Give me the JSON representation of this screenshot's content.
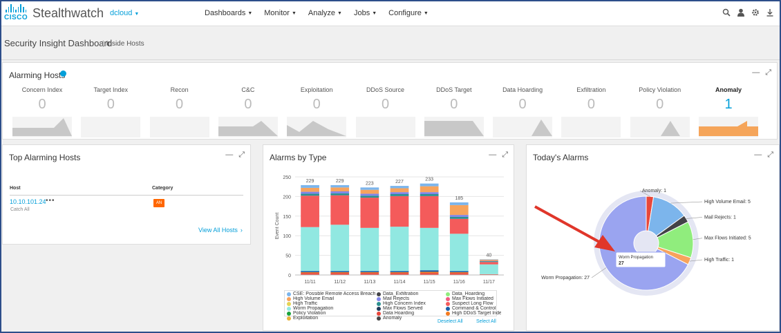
{
  "app": {
    "logo_text": "CISCO",
    "title": "Stealthwatch",
    "tenant": "dcloud"
  },
  "nav": [
    {
      "label": "Dashboards"
    },
    {
      "label": "Monitor"
    },
    {
      "label": "Analyze"
    },
    {
      "label": "Jobs"
    },
    {
      "label": "Configure"
    }
  ],
  "toolbar_icons": [
    "search-icon",
    "user-icon",
    "gear-icon",
    "download-icon"
  ],
  "page": {
    "title": "Security Insight Dashboard",
    "subtitle": "Inside Hosts"
  },
  "alarming_hosts": {
    "title": "Alarming Hosts",
    "tiles": [
      {
        "label": "Concern Index",
        "value": "0"
      },
      {
        "label": "Target Index",
        "value": "0"
      },
      {
        "label": "Recon",
        "value": "0"
      },
      {
        "label": "C&C",
        "value": "0"
      },
      {
        "label": "Exploitation",
        "value": "0"
      },
      {
        "label": "DDoS Source",
        "value": "0"
      },
      {
        "label": "DDoS Target",
        "value": "0"
      },
      {
        "label": "Data Hoarding",
        "value": "0"
      },
      {
        "label": "Exfiltration",
        "value": "0"
      },
      {
        "label": "Policy Violation",
        "value": "0"
      },
      {
        "label": "Anomaly",
        "value": "1"
      }
    ]
  },
  "top_alarming_hosts": {
    "title": "Top Alarming Hosts",
    "col_host": "Host",
    "col_category": "Category",
    "rows": [
      {
        "host": "10.10.101.24",
        "more": "•••",
        "sub": "Catch All",
        "category": "AN"
      }
    ],
    "view_all": "View All Hosts"
  },
  "alarms_by_type": {
    "title": "Alarms by Type",
    "deselect_all": "Deselect All",
    "select_all": "Select All",
    "legend": [
      {
        "label": "CSE: Possible Remote Access Breach",
        "color": "#7cb5ec"
      },
      {
        "label": "Data_Exfiltration",
        "color": "#434348"
      },
      {
        "label": "Data_Hoarding",
        "color": "#90ed7d"
      },
      {
        "label": "High Volume Email",
        "color": "#f7a35c"
      },
      {
        "label": "Mail Rejects",
        "color": "#8085e9"
      },
      {
        "label": "Max Flows Initiated",
        "color": "#f15c80"
      },
      {
        "label": "High Traffic",
        "color": "#e4d354"
      },
      {
        "label": "High Concern Index",
        "color": "#2b908f"
      },
      {
        "label": "Suspect Long Flow",
        "color": "#f45b5b"
      },
      {
        "label": "Worm Propagation",
        "color": "#91e8e1"
      },
      {
        "label": "Max Flows Served",
        "color": "#1f3a5a"
      },
      {
        "label": "Command & Control",
        "color": "#1a5fa8"
      },
      {
        "label": "Policy Violation",
        "color": "#1aa33a"
      },
      {
        "label": "Data Hoarding",
        "color": "#e8473b"
      },
      {
        "label": "High DDoS Target Index",
        "color": "#f47b20"
      },
      {
        "label": "Exploitation",
        "color": "#e8b339"
      },
      {
        "label": "Anomaly",
        "color": "#444444"
      }
    ]
  },
  "todays_alarms": {
    "title": "Today's Alarms",
    "tooltip_label": "Worm Propagation",
    "tooltip_value": "27"
  },
  "chart_data": [
    {
      "type": "bar",
      "title": "Alarms by Type",
      "xlabel": "",
      "ylabel": "Event Count",
      "ylim": [
        0,
        250
      ],
      "yticks": [
        0,
        50,
        100,
        150,
        200,
        250
      ],
      "categories": [
        "11/11",
        "11/12",
        "11/13",
        "11/14",
        "11/15",
        "11/16",
        "11/17"
      ],
      "totals": [
        229,
        229,
        223,
        227,
        233,
        185,
        40
      ],
      "stacked": true,
      "series": [
        {
          "name": "Data Hoarding",
          "color": "#e8473b",
          "values": [
            5,
            5,
            5,
            5,
            5,
            5,
            2
          ]
        },
        {
          "name": "High DDoS Target Index",
          "color": "#f47b20",
          "values": [
            2,
            2,
            2,
            2,
            3,
            2,
            0
          ]
        },
        {
          "name": "Command & Control",
          "color": "#1a5fa8",
          "values": [
            3,
            3,
            3,
            3,
            4,
            3,
            0
          ]
        },
        {
          "name": "Worm Propagation",
          "color": "#91e8e1",
          "values": [
            112,
            118,
            110,
            113,
            108,
            95,
            25
          ]
        },
        {
          "name": "Suspect Long Flow",
          "color": "#f45b5b",
          "values": [
            80,
            75,
            77,
            78,
            81,
            38,
            6
          ]
        },
        {
          "name": "High Concern Index",
          "color": "#2b908f",
          "values": [
            5,
            5,
            5,
            5,
            5,
            5,
            2
          ]
        },
        {
          "name": "Mail Rejects",
          "color": "#8085e9",
          "values": [
            5,
            5,
            5,
            5,
            5,
            5,
            1
          ]
        },
        {
          "name": "High Volume Email",
          "color": "#f7a35c",
          "values": [
            10,
            10,
            10,
            10,
            15,
            25,
            3
          ]
        },
        {
          "name": "CSE: Possible Remote Access Breach",
          "color": "#7cb5ec",
          "values": [
            7,
            6,
            6,
            6,
            7,
            7,
            1
          ]
        }
      ]
    },
    {
      "type": "pie",
      "title": "Today's Alarms",
      "slices": [
        {
          "label": "Anomaly",
          "value": 1,
          "color": "#e8473b"
        },
        {
          "label": "High Volume Email",
          "value": 5,
          "color": "#7cb5ec"
        },
        {
          "label": "Mail Rejects",
          "value": 1,
          "color": "#434348"
        },
        {
          "label": "Max Flows Initiated",
          "value": 5,
          "color": "#90ed7d"
        },
        {
          "label": "High Traffic",
          "value": 1,
          "color": "#f7a35c"
        },
        {
          "label": "Worm Propagation",
          "value": 27,
          "color": "#9aa4f0"
        }
      ]
    }
  ]
}
